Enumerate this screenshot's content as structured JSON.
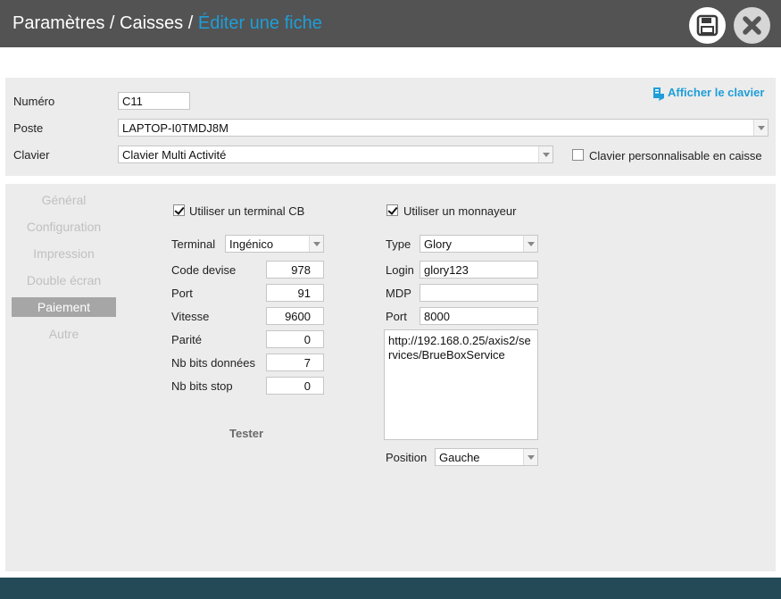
{
  "header": {
    "crumb1": "Paramètres",
    "sep1": " / ",
    "crumb2": "Caisses",
    "sep2": " / ",
    "current": "Éditer une fiche",
    "save_icon": "floppy-disk-icon",
    "close_icon": "close-x-icon"
  },
  "colors": {
    "titlebar": "#535353",
    "accent": "#1e9ed8",
    "panel": "#ececec",
    "footer": "#234a56"
  },
  "top": {
    "numero_label": "Numéro",
    "numero_value": "C11",
    "poste_label": "Poste",
    "poste_value": "LAPTOP-I0TMDJ8M",
    "clavier_label": "Clavier",
    "clavier_value": "Clavier Multi Activité",
    "show_keyboard_link": "Afficher le clavier",
    "custom_keyboard_label": "Clavier personnalisable en caisse",
    "custom_keyboard_checked": false
  },
  "nav": {
    "items": [
      "Général",
      "Configuration",
      "Impression",
      "Double écran",
      "Paiement",
      "Autre"
    ],
    "active": "Paiement"
  },
  "card": {
    "use_label": "Utiliser un terminal CB",
    "use_checked": true,
    "terminal_label": "Terminal",
    "terminal_value": "Ingénico",
    "devise_label": "Code devise",
    "devise_value": "978",
    "port_label": "Port",
    "port_value": "91",
    "vitesse_label": "Vitesse",
    "vitesse_value": "9600",
    "parite_label": "Parité",
    "parite_value": "0",
    "bits_label": "Nb bits données",
    "bits_value": "7",
    "stop_label": "Nb bits stop",
    "stop_value": "0",
    "test_label": "Tester"
  },
  "cash": {
    "use_label": "Utiliser un monnayeur",
    "use_checked": true,
    "type_label": "Type",
    "type_value": "Glory",
    "login_label": "Login",
    "login_value": "glory123",
    "mdp_label": "MDP",
    "mdp_value": "",
    "port_label": "Port",
    "port_value": "8000",
    "url_value": "http://192.168.0.25/axis2/services/BrueBoxService",
    "position_label": "Position",
    "position_value": "Gauche"
  }
}
